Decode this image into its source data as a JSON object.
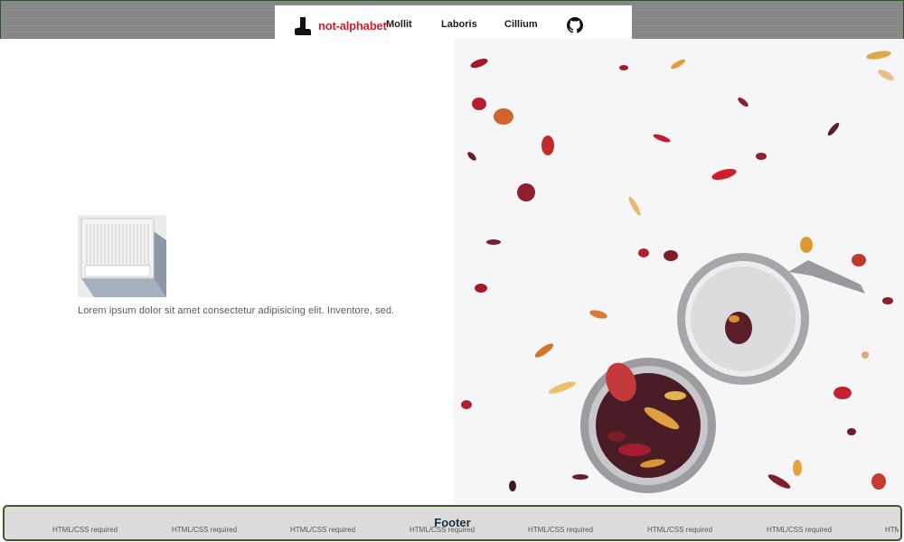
{
  "header": {
    "brand": "not-alphabet",
    "nav": [
      {
        "label": "Mollit"
      },
      {
        "label": "Laboris"
      },
      {
        "label": "Cillium"
      }
    ]
  },
  "main": {
    "lead_text": "Lorem ipsum dolor sit amet consectetur adipisicing elit. Inventore, sed."
  },
  "footer": {
    "title": "Footer",
    "items": [
      "HTML/CSS required",
      "HTML/CSS required",
      "HTML/CSS required",
      "HTML/CSS required",
      "HTML/CSS required",
      "HTML/CSS required",
      "HTML/CSS required",
      "HTML/CSS required"
    ]
  },
  "colors": {
    "brand": "#d21f2a",
    "header_bg": "#8a8a8a",
    "footer_border": "#3d5a2a"
  },
  "icons": [
    "boot-logo-icon",
    "github-icon"
  ]
}
